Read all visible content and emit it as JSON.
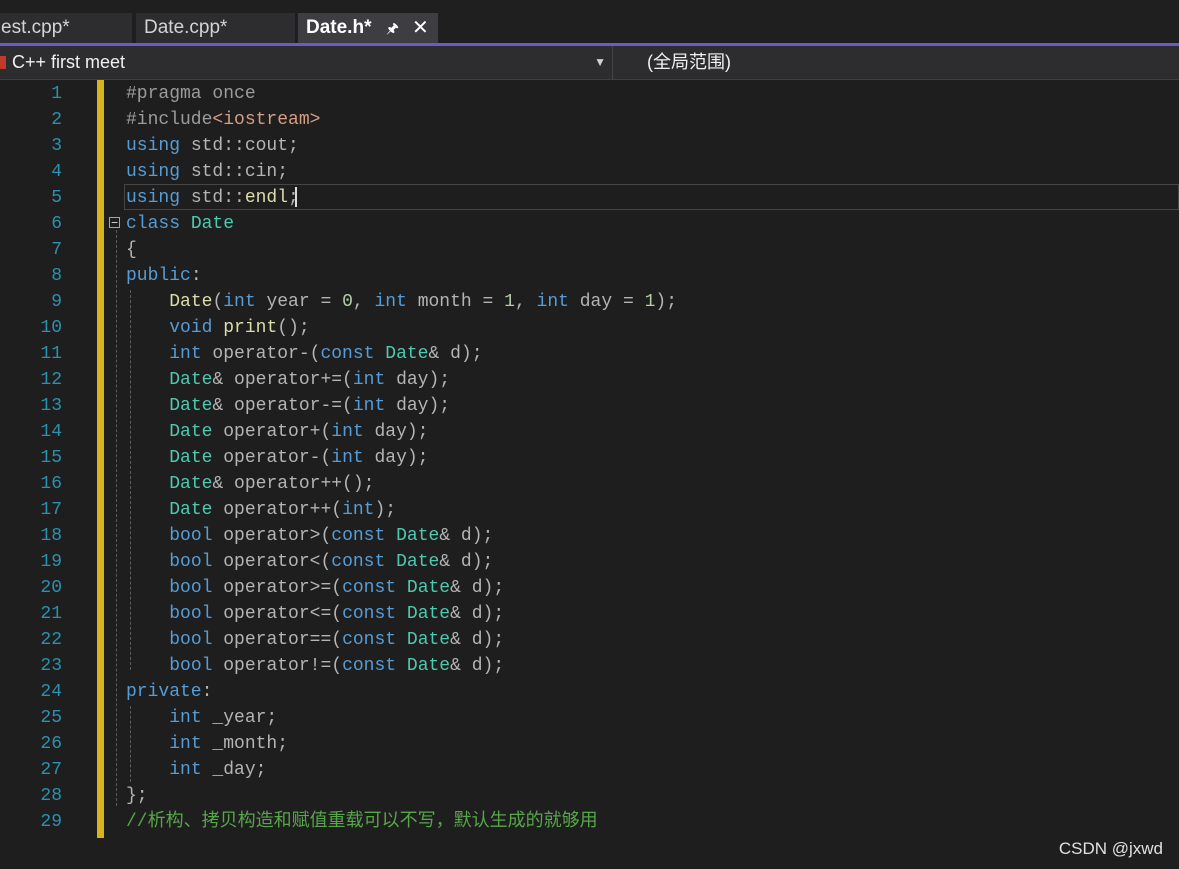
{
  "tabs": [
    {
      "label": "est.cpp*"
    },
    {
      "label": "Date.cpp*"
    },
    {
      "label": "Date.h*",
      "active": true
    }
  ],
  "active_tab": {
    "pin_icon": "pin-icon",
    "close_icon": "close-icon"
  },
  "navbar": {
    "project": "C++ first meet",
    "scope": "(全局范围)"
  },
  "line_numbers": [
    "1",
    "2",
    "3",
    "4",
    "5",
    "6",
    "7",
    "8",
    "9",
    "10",
    "11",
    "12",
    "13",
    "14",
    "15",
    "16",
    "17",
    "18",
    "19",
    "20",
    "21",
    "22",
    "23",
    "24",
    "25",
    "26",
    "27",
    "28",
    "29"
  ],
  "code_lines": [
    [
      {
        "t": "#pragma once",
        "c": "pp"
      }
    ],
    [
      {
        "t": "#include",
        "c": "pp"
      },
      {
        "t": "<iostream>",
        "c": "str"
      }
    ],
    [
      {
        "t": "using",
        "c": "kw"
      },
      {
        "t": " std::cout;",
        "c": "ps"
      }
    ],
    [
      {
        "t": "using",
        "c": "kw"
      },
      {
        "t": " std::cin;",
        "c": "ps"
      }
    ],
    [
      {
        "t": "using",
        "c": "kw"
      },
      {
        "t": " std::",
        "c": "ps"
      },
      {
        "t": "endl",
        "c": "fn"
      },
      {
        "t": ";",
        "c": "ps"
      }
    ],
    [
      {
        "t": "class",
        "c": "kw"
      },
      {
        "t": " ",
        "c": "ps"
      },
      {
        "t": "Date",
        "c": "ty"
      }
    ],
    [
      {
        "t": "{",
        "c": "ps"
      }
    ],
    [
      {
        "t": "public",
        "c": "kw"
      },
      {
        "t": ":",
        "c": "ps"
      }
    ],
    [
      {
        "t": "    ",
        "c": "ps"
      },
      {
        "t": "Date",
        "c": "fn"
      },
      {
        "t": "(",
        "c": "ps"
      },
      {
        "t": "int",
        "c": "kw"
      },
      {
        "t": " year = ",
        "c": "ps"
      },
      {
        "t": "0",
        "c": "num"
      },
      {
        "t": ", ",
        "c": "ps"
      },
      {
        "t": "int",
        "c": "kw"
      },
      {
        "t": " month = ",
        "c": "ps"
      },
      {
        "t": "1",
        "c": "num"
      },
      {
        "t": ", ",
        "c": "ps"
      },
      {
        "t": "int",
        "c": "kw"
      },
      {
        "t": " day = ",
        "c": "ps"
      },
      {
        "t": "1",
        "c": "num"
      },
      {
        "t": ");",
        "c": "ps"
      }
    ],
    [
      {
        "t": "    ",
        "c": "ps"
      },
      {
        "t": "void",
        "c": "kw"
      },
      {
        "t": " ",
        "c": "ps"
      },
      {
        "t": "print",
        "c": "fn"
      },
      {
        "t": "();",
        "c": "ps"
      }
    ],
    [
      {
        "t": "    ",
        "c": "ps"
      },
      {
        "t": "int",
        "c": "kw"
      },
      {
        "t": " operator-(",
        "c": "ps"
      },
      {
        "t": "const",
        "c": "kw"
      },
      {
        "t": " ",
        "c": "ps"
      },
      {
        "t": "Date",
        "c": "ty"
      },
      {
        "t": "& d);",
        "c": "ps"
      }
    ],
    [
      {
        "t": "    ",
        "c": "ps"
      },
      {
        "t": "Date",
        "c": "ty"
      },
      {
        "t": "& operator+=(",
        "c": "ps"
      },
      {
        "t": "int",
        "c": "kw"
      },
      {
        "t": " day);",
        "c": "ps"
      }
    ],
    [
      {
        "t": "    ",
        "c": "ps"
      },
      {
        "t": "Date",
        "c": "ty"
      },
      {
        "t": "& operator-=(",
        "c": "ps"
      },
      {
        "t": "int",
        "c": "kw"
      },
      {
        "t": " day);",
        "c": "ps"
      }
    ],
    [
      {
        "t": "    ",
        "c": "ps"
      },
      {
        "t": "Date",
        "c": "ty"
      },
      {
        "t": " operator+(",
        "c": "ps"
      },
      {
        "t": "int",
        "c": "kw"
      },
      {
        "t": " day);",
        "c": "ps"
      }
    ],
    [
      {
        "t": "    ",
        "c": "ps"
      },
      {
        "t": "Date",
        "c": "ty"
      },
      {
        "t": " operator-(",
        "c": "ps"
      },
      {
        "t": "int",
        "c": "kw"
      },
      {
        "t": " day);",
        "c": "ps"
      }
    ],
    [
      {
        "t": "    ",
        "c": "ps"
      },
      {
        "t": "Date",
        "c": "ty"
      },
      {
        "t": "& operator++();",
        "c": "ps"
      }
    ],
    [
      {
        "t": "    ",
        "c": "ps"
      },
      {
        "t": "Date",
        "c": "ty"
      },
      {
        "t": " operator++(",
        "c": "ps"
      },
      {
        "t": "int",
        "c": "kw"
      },
      {
        "t": ");",
        "c": "ps"
      }
    ],
    [
      {
        "t": "    ",
        "c": "ps"
      },
      {
        "t": "bool",
        "c": "kw"
      },
      {
        "t": " operator>(",
        "c": "ps"
      },
      {
        "t": "const",
        "c": "kw"
      },
      {
        "t": " ",
        "c": "ps"
      },
      {
        "t": "Date",
        "c": "ty"
      },
      {
        "t": "& d);",
        "c": "ps"
      }
    ],
    [
      {
        "t": "    ",
        "c": "ps"
      },
      {
        "t": "bool",
        "c": "kw"
      },
      {
        "t": " operator<(",
        "c": "ps"
      },
      {
        "t": "const",
        "c": "kw"
      },
      {
        "t": " ",
        "c": "ps"
      },
      {
        "t": "Date",
        "c": "ty"
      },
      {
        "t": "& d);",
        "c": "ps"
      }
    ],
    [
      {
        "t": "    ",
        "c": "ps"
      },
      {
        "t": "bool",
        "c": "kw"
      },
      {
        "t": " operator>=(",
        "c": "ps"
      },
      {
        "t": "const",
        "c": "kw"
      },
      {
        "t": " ",
        "c": "ps"
      },
      {
        "t": "Date",
        "c": "ty"
      },
      {
        "t": "& d);",
        "c": "ps"
      }
    ],
    [
      {
        "t": "    ",
        "c": "ps"
      },
      {
        "t": "bool",
        "c": "kw"
      },
      {
        "t": " operator<=(",
        "c": "ps"
      },
      {
        "t": "const",
        "c": "kw"
      },
      {
        "t": " ",
        "c": "ps"
      },
      {
        "t": "Date",
        "c": "ty"
      },
      {
        "t": "& d);",
        "c": "ps"
      }
    ],
    [
      {
        "t": "    ",
        "c": "ps"
      },
      {
        "t": "bool",
        "c": "kw"
      },
      {
        "t": " operator==(",
        "c": "ps"
      },
      {
        "t": "const",
        "c": "kw"
      },
      {
        "t": " ",
        "c": "ps"
      },
      {
        "t": "Date",
        "c": "ty"
      },
      {
        "t": "& d);",
        "c": "ps"
      }
    ],
    [
      {
        "t": "    ",
        "c": "ps"
      },
      {
        "t": "bool",
        "c": "kw"
      },
      {
        "t": " operator!=(",
        "c": "ps"
      },
      {
        "t": "const",
        "c": "kw"
      },
      {
        "t": " ",
        "c": "ps"
      },
      {
        "t": "Date",
        "c": "ty"
      },
      {
        "t": "& d);",
        "c": "ps"
      }
    ],
    [
      {
        "t": "private",
        "c": "kw"
      },
      {
        "t": ":",
        "c": "ps"
      }
    ],
    [
      {
        "t": "    ",
        "c": "ps"
      },
      {
        "t": "int",
        "c": "kw"
      },
      {
        "t": " _year;",
        "c": "ps"
      }
    ],
    [
      {
        "t": "    ",
        "c": "ps"
      },
      {
        "t": "int",
        "c": "kw"
      },
      {
        "t": " _month;",
        "c": "ps"
      }
    ],
    [
      {
        "t": "    ",
        "c": "ps"
      },
      {
        "t": "int",
        "c": "kw"
      },
      {
        "t": " _day;",
        "c": "ps"
      }
    ],
    [
      {
        "t": "};",
        "c": "ps"
      }
    ],
    [
      {
        "t": "//析构、拷贝构造和赋值重载可以不写，默认生成的就够用",
        "c": "cm"
      }
    ]
  ],
  "watermark": "CSDN @jxwd",
  "colors": {
    "accent": "#6c5ac8",
    "change_bar": "#d7b31e",
    "keyword": "#569cd6",
    "type": "#4ec9b0",
    "function": "#dcdcaa",
    "comment": "#57a64a",
    "line_number": "#2b91af"
  }
}
